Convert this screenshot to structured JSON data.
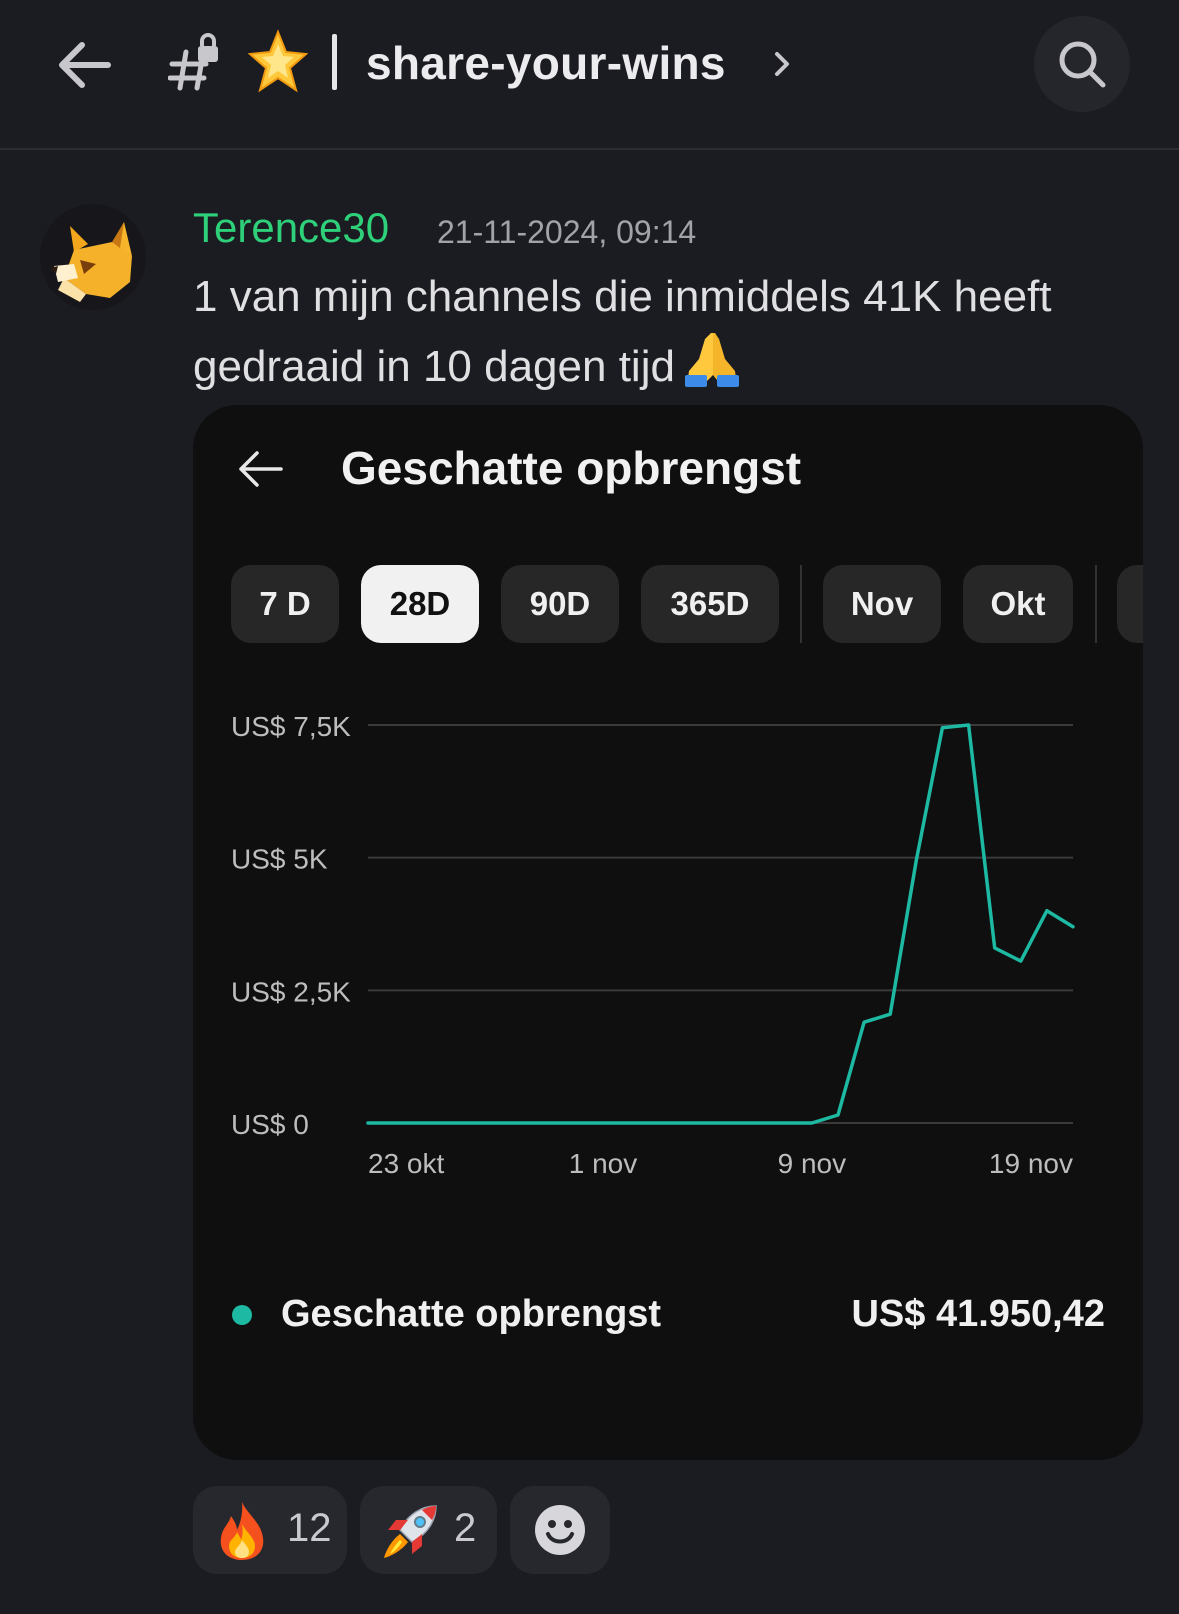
{
  "header": {
    "channel_name": "share-your-wins",
    "icons": {
      "back": "arrow-left-icon",
      "channel": "hashtag-lock-icon",
      "star": "glowing-star-emoji",
      "chevron": "chevron-right-icon",
      "search": "search-icon"
    }
  },
  "message": {
    "username": "Terence30",
    "username_color": "#2fd07a",
    "timestamp": "21-11-2024, 09:14",
    "text": "1 van mijn channels die inmiddels 41K heeft gedraaid in 10 dagen tijd",
    "trailing_emoji": "folded-hands-emoji"
  },
  "card": {
    "title": "Geschatte opbrengst",
    "chips": [
      {
        "label": "7 D",
        "active": false
      },
      {
        "label": "28D",
        "active": true
      },
      {
        "label": "90D",
        "active": false
      },
      {
        "label": "365D",
        "active": false
      },
      {
        "label": "Nov",
        "active": false
      },
      {
        "label": "Okt",
        "active": false
      }
    ],
    "legend": {
      "label": "Geschatte opbrengst",
      "value": "US$ 41.950,42",
      "color": "#1db9a2"
    }
  },
  "chart_data": {
    "type": "line",
    "title": "",
    "y_tick_labels": [
      "US$ 0",
      "US$ 2,5K",
      "US$ 5K",
      "US$ 7,5K"
    ],
    "y_ticks": [
      0,
      2500,
      5000,
      7500
    ],
    "ylim": [
      0,
      7500
    ],
    "x_tick_labels": [
      "23 okt",
      "1 nov",
      "9 nov",
      "19 nov"
    ],
    "x_ticks": [
      "2024-10-23",
      "2024-11-01",
      "2024-11-09",
      "2024-11-19"
    ],
    "grid": true,
    "line_color": "#1db9a2",
    "series": [
      {
        "x": [
          "2024-10-23",
          "2024-10-24",
          "2024-10-25",
          "2024-10-26",
          "2024-10-27",
          "2024-10-28",
          "2024-10-29",
          "2024-10-30",
          "2024-10-31",
          "2024-11-01",
          "2024-11-02",
          "2024-11-03",
          "2024-11-04",
          "2024-11-05",
          "2024-11-06",
          "2024-11-07",
          "2024-11-08",
          "2024-11-09",
          "2024-11-10",
          "2024-11-11",
          "2024-11-12",
          "2024-11-13",
          "2024-11-14",
          "2024-11-15",
          "2024-11-16",
          "2024-11-17",
          "2024-11-18",
          "2024-11-19"
        ],
        "values": [
          0,
          0,
          0,
          0,
          0,
          0,
          0,
          0,
          0,
          0,
          0,
          0,
          0,
          0,
          0,
          0,
          0,
          0,
          150,
          1900,
          2050,
          4950,
          7450,
          7500,
          3300,
          3050,
          4000,
          3700
        ]
      }
    ]
  },
  "reactions": [
    {
      "emoji": "fire-emoji",
      "count": "12"
    },
    {
      "emoji": "rocket-emoji",
      "count": "2"
    },
    {
      "emoji": "add-reaction-smiley-icon",
      "count": ""
    }
  ]
}
